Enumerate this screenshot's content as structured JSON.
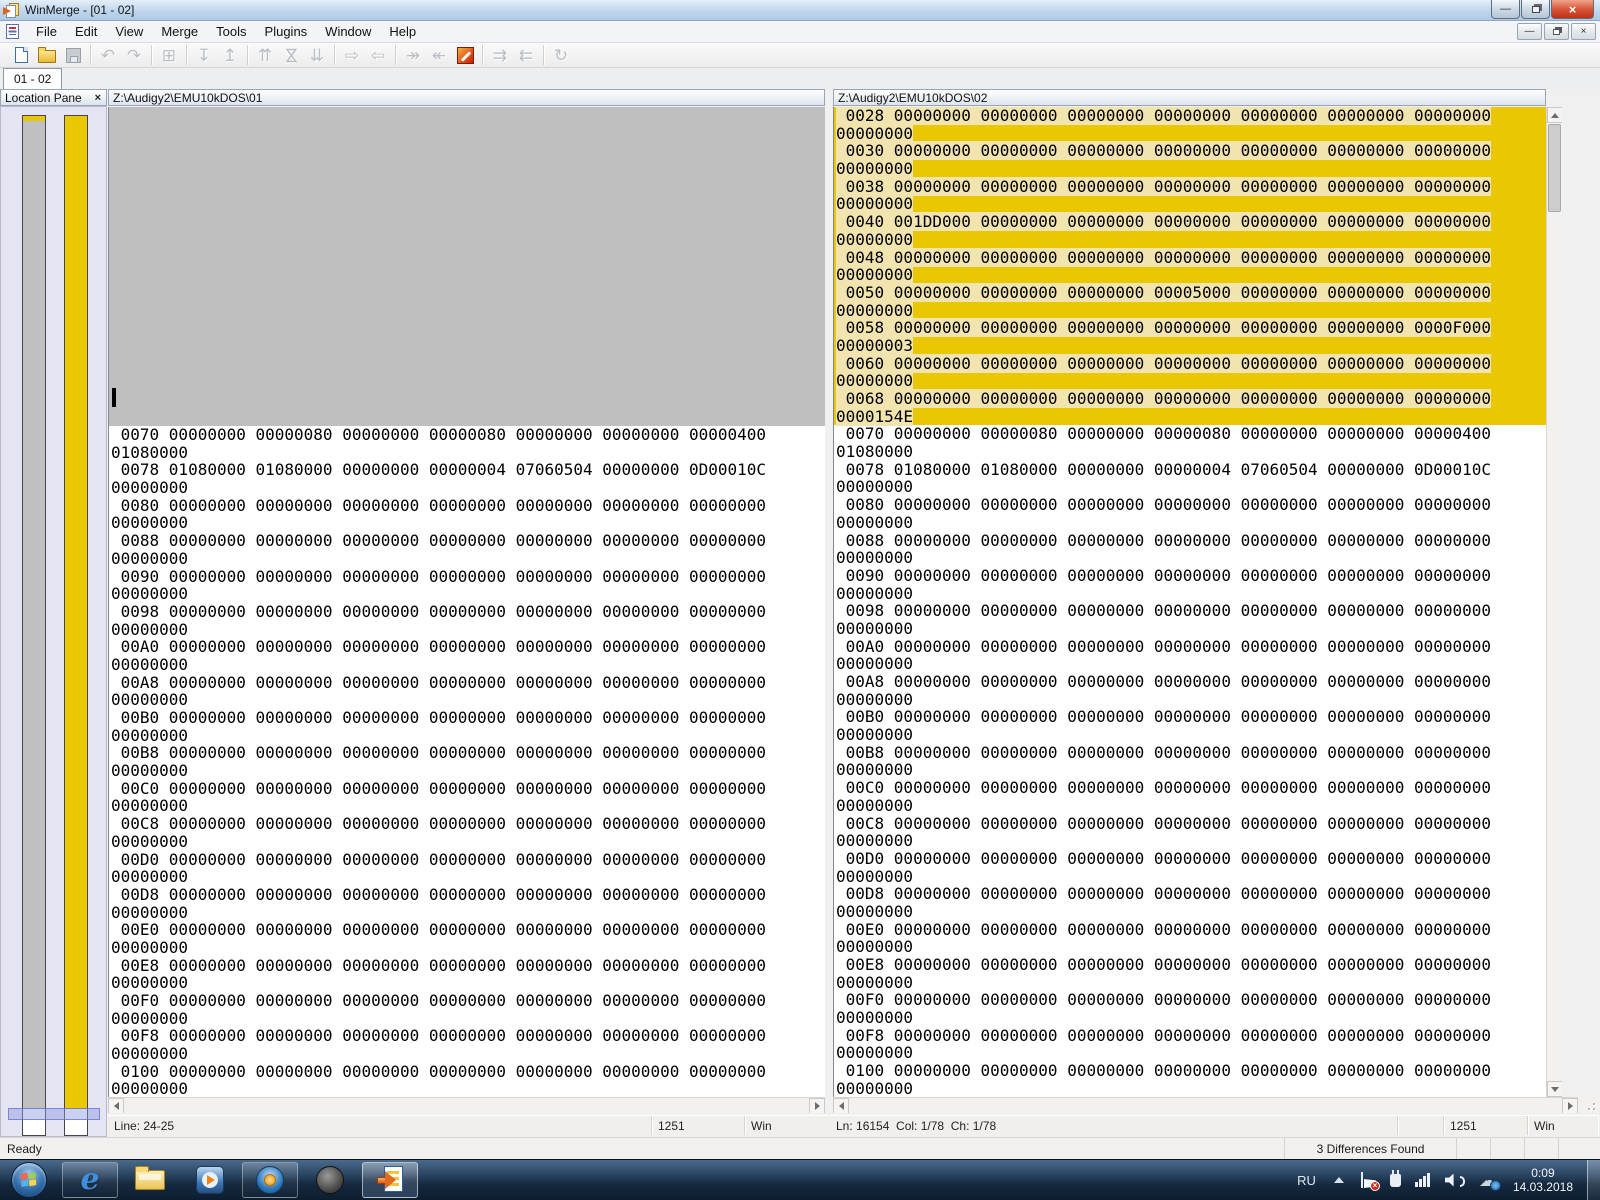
{
  "window": {
    "title": "WinMerge - [01 - 02]"
  },
  "menu": {
    "items": [
      "File",
      "Edit",
      "View",
      "Merge",
      "Tools",
      "Plugins",
      "Window",
      "Help"
    ]
  },
  "toolbar": {
    "buttons": [
      {
        "name": "new-file-icon",
        "type": "new",
        "enabled": true
      },
      {
        "name": "open-icon",
        "type": "open",
        "enabled": true
      },
      {
        "name": "save-icon",
        "type": "save",
        "enabled": false
      },
      {
        "sep": true
      },
      {
        "name": "undo-icon",
        "glyph": "↶",
        "enabled": false
      },
      {
        "name": "redo-icon",
        "glyph": "↷",
        "enabled": false
      },
      {
        "sep": true
      },
      {
        "name": "file-merge-mode-icon",
        "glyph": "⊞",
        "enabled": false
      },
      {
        "sep": true
      },
      {
        "name": "next-difference-icon",
        "glyph": "↧",
        "enabled": false
      },
      {
        "name": "previous-difference-icon",
        "glyph": "↥",
        "enabled": false
      },
      {
        "sep": true
      },
      {
        "name": "first-difference-icon",
        "glyph": "⇈",
        "enabled": false
      },
      {
        "name": "current-difference-icon",
        "glyph": "⋈",
        "enabled": false,
        "rot": true
      },
      {
        "name": "last-difference-icon",
        "glyph": "⇊",
        "enabled": false
      },
      {
        "sep": true
      },
      {
        "name": "copy-right-icon",
        "glyph": "⇨",
        "enabled": false
      },
      {
        "name": "copy-left-icon",
        "glyph": "⇦",
        "enabled": false
      },
      {
        "sep": true
      },
      {
        "name": "copy-right-advance-icon",
        "glyph": "↠",
        "enabled": false
      },
      {
        "name": "copy-left-advance-icon",
        "glyph": "↞",
        "enabled": false
      },
      {
        "name": "options-icon",
        "type": "options",
        "enabled": true
      },
      {
        "sep": true
      },
      {
        "name": "next-pair-icon",
        "glyph": "⇉",
        "enabled": false
      },
      {
        "name": "previous-pair-icon",
        "glyph": "⇇",
        "enabled": false
      },
      {
        "sep": true
      },
      {
        "name": "refresh-icon",
        "glyph": "↻",
        "enabled": false
      }
    ]
  },
  "tab": {
    "label": "01 - 02"
  },
  "location_pane": {
    "title": "Location Pane",
    "close_label": "×"
  },
  "left_pane": {
    "path": "Z:\\Audigy2\\EMU10kDOS\\01",
    "status": {
      "position": "Line: 24-25",
      "encoding": "1251",
      "eol": "Win"
    }
  },
  "right_pane": {
    "path": "Z:\\Audigy2\\EMU10kDOS\\02",
    "status": {
      "position": "Ln: 16154  Col: 1/78  Ch: 1/78",
      "encoding": "1251",
      "eol": "Win"
    }
  },
  "colors": {
    "diff_text_bg": "#F2E4AE",
    "diff_trailing_bg": "#EAC703",
    "blank_block_gray": "#BFBFBF",
    "location_gray_bar": "#C0C0C0",
    "location_yellow_bar": "#EAC703"
  },
  "editors": {
    "right_diff_lines": [
      {
        "a": " 0028 00000000 00000000 00000000 00000000 00000000 00000000 00000000",
        "w": "00000000"
      },
      {
        "a": " 0030 00000000 00000000 00000000 00000000 00000000 00000000 00000000",
        "w": "00000000"
      },
      {
        "a": " 0038 00000000 00000000 00000000 00000000 00000000 00000000 00000000",
        "w": "00000000"
      },
      {
        "a": " 0040 001DD000 00000000 00000000 00000000 00000000 00000000 00000000",
        "w": "00000000"
      },
      {
        "a": " 0048 00000000 00000000 00000000 00000000 00000000 00000000 00000000",
        "w": "00000000"
      },
      {
        "a": " 0050 00000000 00000000 00000000 00005000 00000000 00000000 00000000",
        "w": "00000000"
      },
      {
        "a": " 0058 00000000 00000000 00000000 00000000 00000000 00000000 0000F000",
        "w": "00000003"
      },
      {
        "a": " 0060 00000000 00000000 00000000 00000000 00000000 00000000 00000000",
        "w": "00000000"
      },
      {
        "a": " 0068 00000000 00000000 00000000 00000000 00000000 00000000 00000000",
        "w": "0000154E"
      }
    ],
    "shared_lines": [
      {
        "a": " 0070 00000000 00000080 00000000 00000080 00000000 00000000 00000400",
        "w": "01080000"
      },
      {
        "a": " 0078 01080000 01080000 00000000 00000004 07060504 00000000 0D00010C",
        "w": "00000000"
      },
      {
        "a": " 0080 00000000 00000000 00000000 00000000 00000000 00000000 00000000",
        "w": "00000000"
      },
      {
        "a": " 0088 00000000 00000000 00000000 00000000 00000000 00000000 00000000",
        "w": "00000000"
      },
      {
        "a": " 0090 00000000 00000000 00000000 00000000 00000000 00000000 00000000",
        "w": "00000000"
      },
      {
        "a": " 0098 00000000 00000000 00000000 00000000 00000000 00000000 00000000",
        "w": "00000000"
      },
      {
        "a": " 00A0 00000000 00000000 00000000 00000000 00000000 00000000 00000000",
        "w": "00000000"
      },
      {
        "a": " 00A8 00000000 00000000 00000000 00000000 00000000 00000000 00000000",
        "w": "00000000"
      },
      {
        "a": " 00B0 00000000 00000000 00000000 00000000 00000000 00000000 00000000",
        "w": "00000000"
      },
      {
        "a": " 00B8 00000000 00000000 00000000 00000000 00000000 00000000 00000000",
        "w": "00000000"
      },
      {
        "a": " 00C0 00000000 00000000 00000000 00000000 00000000 00000000 00000000",
        "w": "00000000"
      },
      {
        "a": " 00C8 00000000 00000000 00000000 00000000 00000000 00000000 00000000",
        "w": "00000000"
      },
      {
        "a": " 00D0 00000000 00000000 00000000 00000000 00000000 00000000 00000000",
        "w": "00000000"
      },
      {
        "a": " 00D8 00000000 00000000 00000000 00000000 00000000 00000000 00000000",
        "w": "00000000"
      },
      {
        "a": " 00E0 00000000 00000000 00000000 00000000 00000000 00000000 00000000",
        "w": "00000000"
      },
      {
        "a": " 00E8 00000000 00000000 00000000 00000000 00000000 00000000 00000000",
        "w": "00000000"
      },
      {
        "a": " 00F0 00000000 00000000 00000000 00000000 00000000 00000000 00000000",
        "w": "00000000"
      },
      {
        "a": " 00F8 00000000 00000000 00000000 00000000 00000000 00000000 00000000",
        "w": "00000000"
      },
      {
        "a": " 0100 00000000 00000000 00000000 00000000 00000000 00000000 00000000",
        "w": "00000000"
      }
    ]
  },
  "status_bar": {
    "ready": "Ready",
    "differences": "3 Differences Found"
  },
  "taskbar": {
    "tray": {
      "lang": "RU",
      "time": "0:09",
      "date": "14.03.2018"
    }
  }
}
